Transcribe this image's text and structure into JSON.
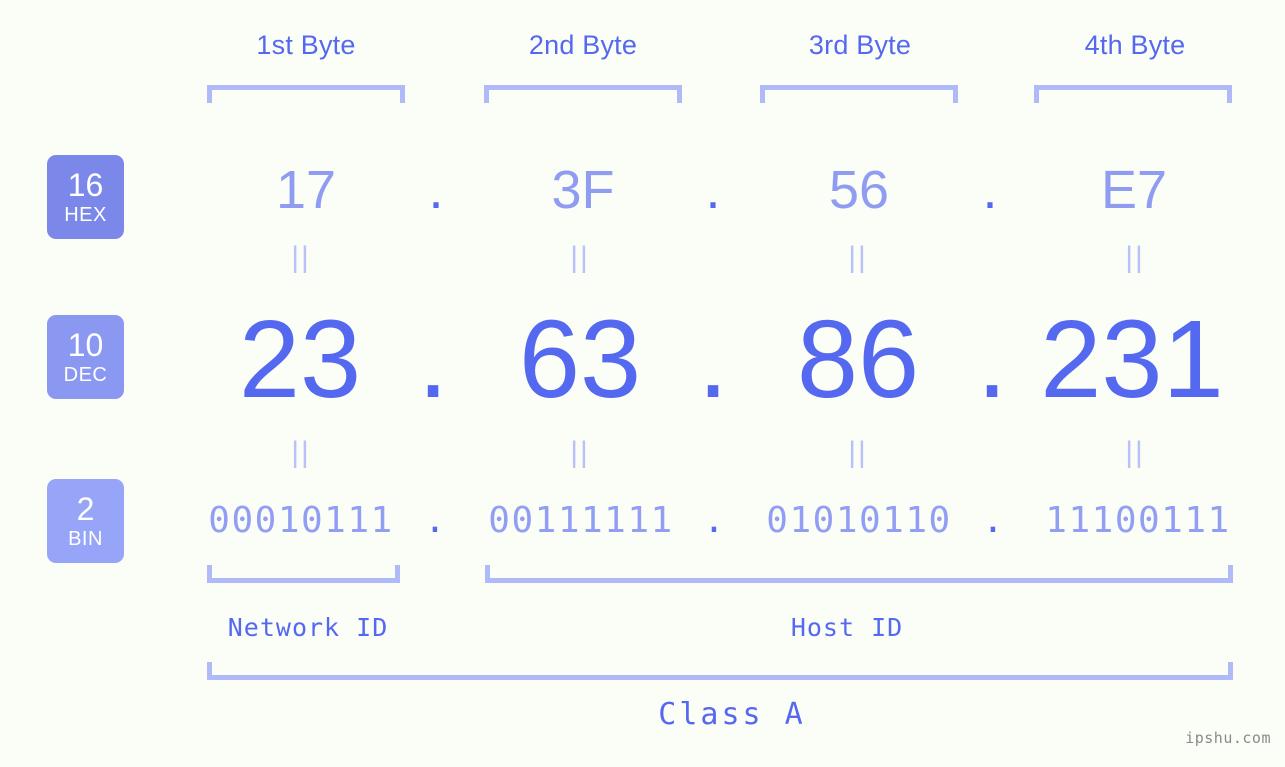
{
  "background_color": "#fbfdf7",
  "accent_colors": {
    "strong_blue": "#5568f0",
    "mid_blue": "#909cf2",
    "light_blue": "#b0baf8",
    "badge_hex": "#7b88ea",
    "badge_dec": "#8b98f1",
    "badge_bin": "#96a5f7"
  },
  "byte_headers": [
    {
      "label": "1st Byte"
    },
    {
      "label": "2nd Byte"
    },
    {
      "label": "3rd Byte"
    },
    {
      "label": "4th Byte"
    }
  ],
  "bases": [
    {
      "number": "16",
      "name": "HEX"
    },
    {
      "number": "10",
      "name": "DEC"
    },
    {
      "number": "2",
      "name": "BIN"
    }
  ],
  "rows": {
    "hex": {
      "values": [
        "17",
        "3F",
        "56",
        "E7"
      ],
      "separator": "."
    },
    "dec": {
      "values": [
        "23",
        "63",
        "86",
        "231"
      ],
      "separator": "."
    },
    "bin": {
      "values": [
        "00010111",
        "00111111",
        "01010110",
        "11100111"
      ],
      "separator": "."
    }
  },
  "equals_marks": {
    "hex_to_dec": [
      "||",
      "||",
      "||",
      "||"
    ],
    "dec_to_bin": [
      "||",
      "||",
      "||",
      "||"
    ]
  },
  "id_sections": [
    {
      "label": "Network ID"
    },
    {
      "label": "Host ID"
    }
  ],
  "class_label": "Class A",
  "watermark": "ipshu.com"
}
